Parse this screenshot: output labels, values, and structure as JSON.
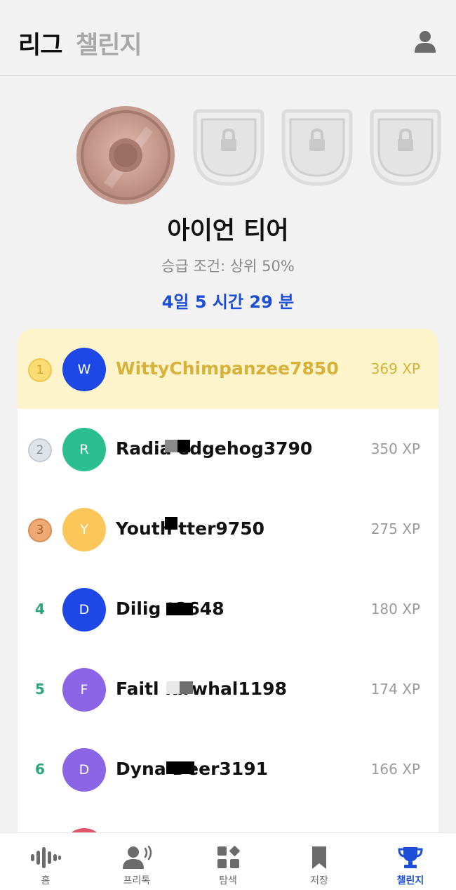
{
  "header": {
    "tab_league": "리그",
    "tab_challenge": "챌린지",
    "profile_icon": "user-icon"
  },
  "tier": {
    "title": "아이언 티어",
    "promotion": "승급 조건: 상위 50%",
    "time_left": "4일 5 시간 29 분"
  },
  "leaderboard": [
    {
      "rank": "1",
      "initial": "W",
      "name": "WittyChimpanzee7850",
      "xp": "369 XP",
      "avatar_color": "#1d47e6",
      "medal": "gold",
      "me": true
    },
    {
      "rank": "2",
      "initial": "R",
      "name": "Radia edgehog3790",
      "xp": "350 XP",
      "avatar_color": "#2bbf8f",
      "medal": "silver"
    },
    {
      "rank": "3",
      "initial": "Y",
      "name": "Youth tter9750",
      "xp": "275 XP",
      "avatar_color": "#fcc75a",
      "medal": "bronze"
    },
    {
      "rank": "4",
      "initial": "D",
      "name": "Dilig t2648",
      "xp": "180 XP",
      "avatar_color": "#1d47e6"
    },
    {
      "rank": "5",
      "initial": "F",
      "name": "Faitl larwhal1198",
      "xp": "174 XP",
      "avatar_color": "#8c64e6"
    },
    {
      "rank": "6",
      "initial": "D",
      "name": "Dyna Deer3191",
      "xp": "166 XP",
      "avatar_color": "#8c64e6"
    }
  ],
  "bottom_nav": [
    {
      "label": "홈",
      "icon": "voice-wave-icon"
    },
    {
      "label": "프리톡",
      "icon": "speaking-person-icon"
    },
    {
      "label": "탐색",
      "icon": "grid-explore-icon"
    },
    {
      "label": "저장",
      "icon": "bookmark-icon"
    },
    {
      "label": "챌린지",
      "icon": "trophy-icon",
      "active": true
    }
  ],
  "colors": {
    "accent": "#1d4ed8",
    "highlight_row": "#fdf4cc",
    "gold_text": "#d6b23b",
    "rank_green": "#2aa57a"
  }
}
